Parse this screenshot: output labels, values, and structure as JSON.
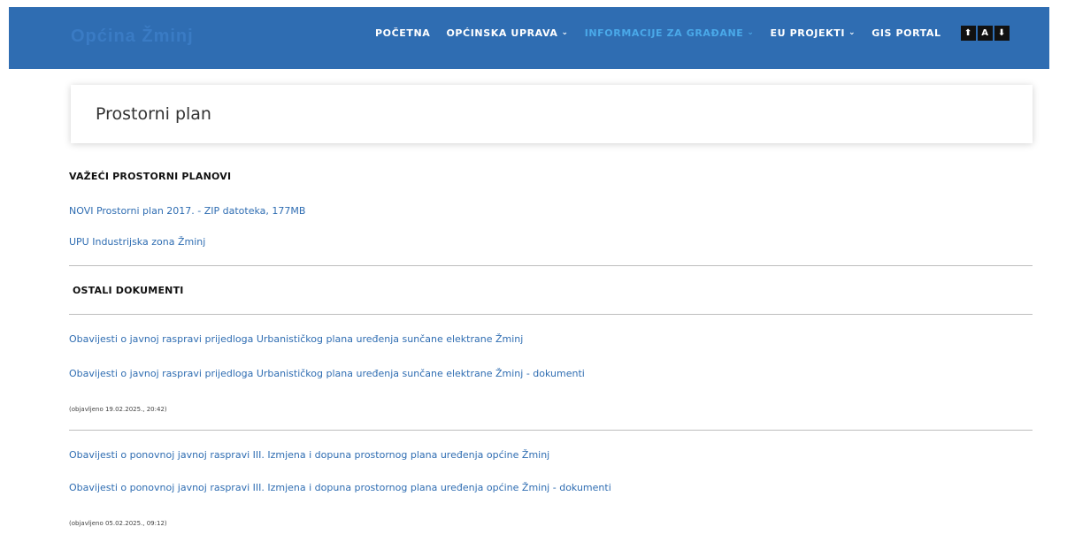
{
  "header": {
    "logo_text": "Općina Žminj",
    "nav": [
      {
        "label": "POČETNA",
        "has_caret": false,
        "active": false
      },
      {
        "label": "OPĆINSKA UPRAVA",
        "has_caret": true,
        "active": false
      },
      {
        "label": "INFORMACIJE ZA GRAĐANE",
        "has_caret": true,
        "active": true
      },
      {
        "label": "EU PROJEKTI",
        "has_caret": true,
        "active": false
      },
      {
        "label": "GIS PORTAL",
        "has_caret": false,
        "active": false
      }
    ],
    "caret_glyph": "⌄",
    "accessibility_buttons": [
      "⬆",
      "A",
      "⬇"
    ]
  },
  "page": {
    "title": "Prostorni plan"
  },
  "sections": {
    "valid": {
      "heading": "VAŽEĆI PROSTORNI PLANOVI",
      "links": [
        "NOVI Prostorni plan 2017. - ZIP datoteka, 177MB",
        "UPU Industrijska zona Žminj"
      ]
    },
    "other": {
      "heading": "OSTALI DOKUMENTI",
      "groups": [
        {
          "links": [
            "Obavijesti o javnoj raspravi prijedloga Urbanističkog plana uređenja sunčane elektrane Žminj",
            "Obavijesti o javnoj raspravi prijedloga Urbanističkog plana uređenja sunčane elektrane Žminj - dokumenti"
          ],
          "published": "(objavljeno 19.02.2025., 20:42)"
        },
        {
          "links": [
            "Obavijesti o ponovnoj javnoj raspravi III. Izmjena i dopuna prostornog plana uređenja općine Žminj",
            "Obavijesti o ponovnoj javnoj raspravi III. Izmjena i dopuna prostornog plana uređenja općine Žminj - dokumenti"
          ],
          "published": "(objavljeno 05.02.2025., 09:12)"
        }
      ]
    }
  },
  "colors": {
    "header_bg": "#2f6db2",
    "active_nav": "#4aa9e9",
    "link": "#2f6db2"
  }
}
